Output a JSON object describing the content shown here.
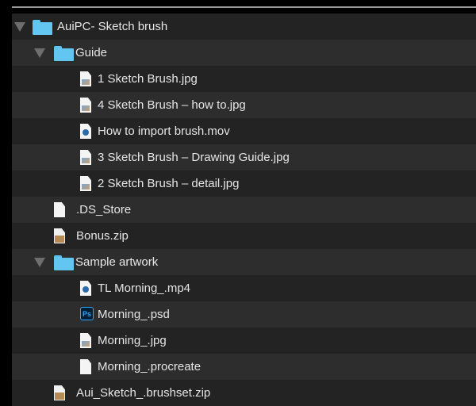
{
  "tree": [
    {
      "name": "AuiPC- Sketch brush",
      "type": "folder",
      "depth": 0,
      "expanded": true
    },
    {
      "name": "Guide",
      "type": "folder",
      "depth": 1,
      "expanded": true
    },
    {
      "name": "1 Sketch Brush.jpg",
      "type": "image",
      "depth": 2
    },
    {
      "name": "4 Sketch Brush – how to.jpg",
      "type": "image",
      "depth": 2
    },
    {
      "name": "How to import brush.mov",
      "type": "video",
      "depth": 2
    },
    {
      "name": "3 Sketch Brush – Drawing Guide.jpg",
      "type": "image",
      "depth": 2
    },
    {
      "name": "2 Sketch Brush – detail.jpg",
      "type": "image",
      "depth": 2
    },
    {
      "name": ".DS_Store",
      "type": "file",
      "depth": 1
    },
    {
      "name": "Bonus.zip",
      "type": "zip",
      "depth": 1
    },
    {
      "name": "Sample artwork",
      "type": "folder",
      "depth": 1,
      "expanded": true
    },
    {
      "name": "TL Morning_.mp4",
      "type": "video",
      "depth": 2
    },
    {
      "name": "Morning_.psd",
      "type": "psd",
      "depth": 2,
      "icon_text": "Ps"
    },
    {
      "name": "Morning_.jpg",
      "type": "image",
      "depth": 2
    },
    {
      "name": "Morning_.procreate",
      "type": "file",
      "depth": 2
    },
    {
      "name": "Aui_Sketch_.brushset.zip",
      "type": "zip",
      "depth": 1
    }
  ],
  "colors": {
    "folder": "#62c6f0",
    "row_odd": "#232323",
    "row_even": "#2d2d2d"
  }
}
